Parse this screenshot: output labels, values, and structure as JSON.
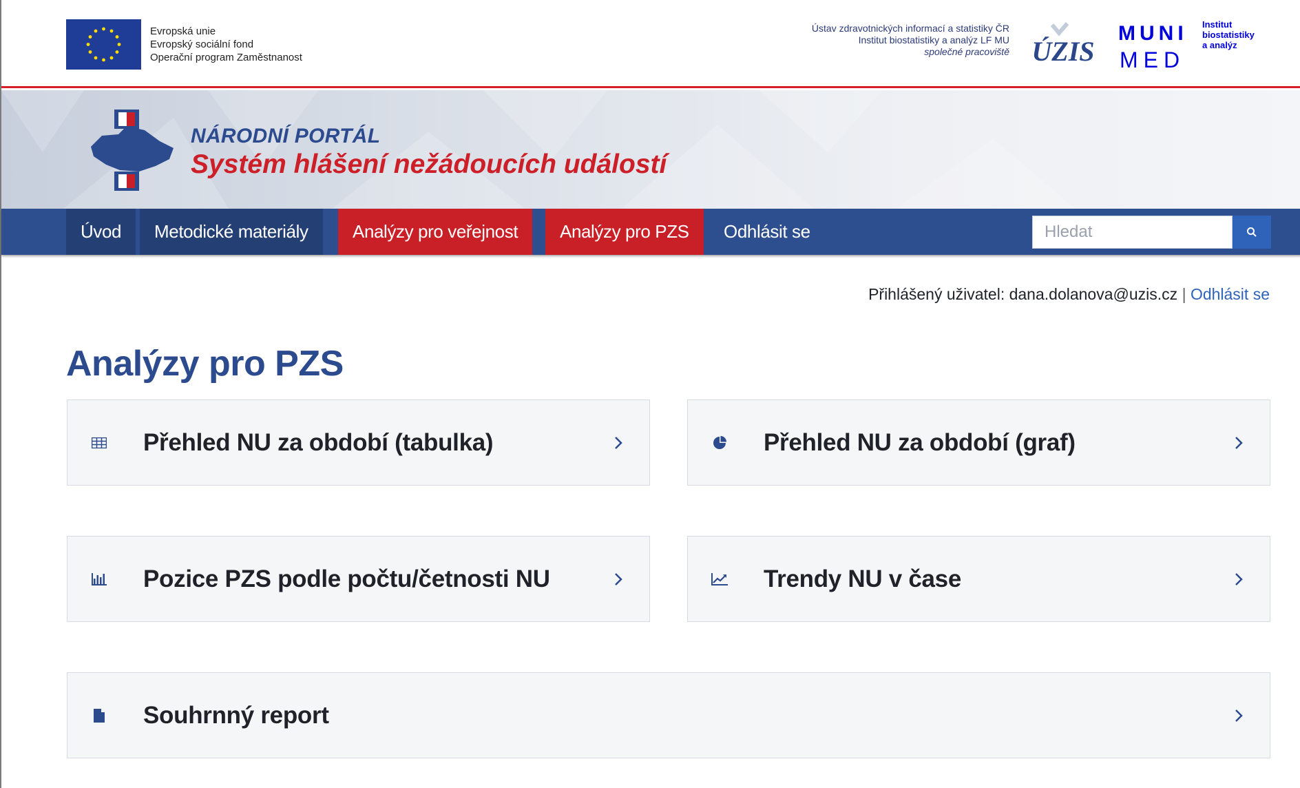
{
  "header": {
    "eu_lines": [
      "Evropská unie",
      "Evropský sociální fond",
      "Operační program Zaměstnanost"
    ],
    "inst_lines": [
      "Ústav zdravotnických informací a statistiky ČR",
      "Institut biostatistiky a analýz LF MU",
      "společné pracoviště"
    ],
    "uzis_logo_text": "ÚZIS",
    "muni_logo_text": [
      "MUNI",
      "MED"
    ],
    "inst_logo_lines": [
      "Institut",
      "biostatistiky",
      "a analýz"
    ]
  },
  "banner": {
    "title_small": "NÁRODNÍ PORTÁL",
    "title_large": "Systém hlášení nežádoucích událostí"
  },
  "nav": {
    "items": [
      {
        "label": "Úvod"
      },
      {
        "label": "Metodické materiály"
      },
      {
        "label": "Analýzy pro veřejnost"
      },
      {
        "label": "Analýzy pro PZS"
      },
      {
        "label": "Odhlásit se"
      }
    ],
    "search_placeholder": "Hledat"
  },
  "user": {
    "prefix": "Přihlášený uživatel: dana.dolanova@uzis.cz",
    "separator": "|",
    "logout": "Odhlásit se"
  },
  "page": {
    "title": "Analýzy pro PZS"
  },
  "cards": [
    {
      "label": "Přehled NU za období (tabulka)",
      "icon": "table-icon"
    },
    {
      "label": "Přehled NU za období (graf)",
      "icon": "pie-chart-icon"
    },
    {
      "label": "Pozice PZS podle počtu/četnosti NU",
      "icon": "bar-chart-icon"
    },
    {
      "label": "Trendy NU v čase",
      "icon": "line-chart-icon"
    },
    {
      "label": "Souhrnný report",
      "icon": "file-icon"
    }
  ],
  "colors": {
    "brand_blue": "#2e4f8f",
    "brand_red": "#c91f26",
    "link_blue": "#2e63b9",
    "title_blue": "#2c4a8e"
  }
}
